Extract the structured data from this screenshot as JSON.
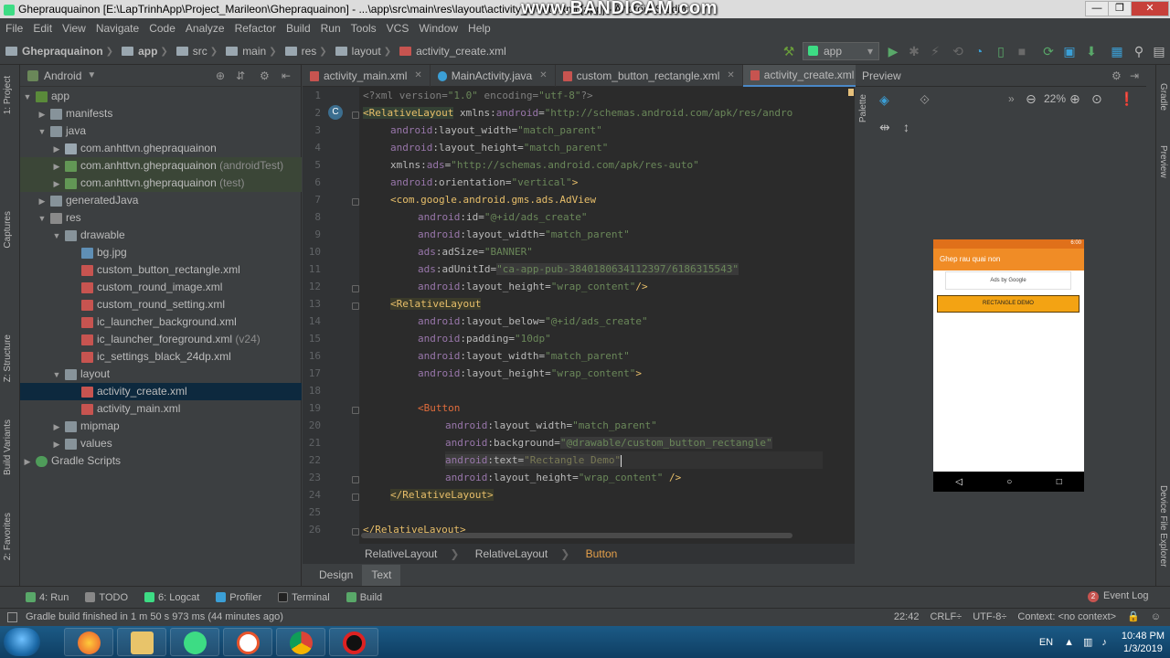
{
  "window": {
    "title": "Gheprauquainon [E:\\LapTrinhApp\\Project_Marileon\\Ghepraquainon] - ...\\app\\src\\main\\res\\layout\\activity_create.xml [app] - Android Studio",
    "watermark": "www.BANDICAM.com",
    "min": "—",
    "max": "❐",
    "close": "✕"
  },
  "menu": [
    "File",
    "Edit",
    "View",
    "Navigate",
    "Code",
    "Analyze",
    "Refactor",
    "Build",
    "Run",
    "Tools",
    "VCS",
    "Window",
    "Help"
  ],
  "breadcrumb": [
    "Ghepraquainon",
    "app",
    "src",
    "main",
    "res",
    "layout",
    "activity_create.xml"
  ],
  "run_config": "app",
  "left_strip": [
    "1: Project",
    "Captures",
    "Z: Structure",
    "Build Variants",
    "2: Favorites"
  ],
  "project": {
    "view": "Android",
    "tree": [
      {
        "label": "app",
        "suffix": ""
      },
      {
        "label": "manifests",
        "suffix": ""
      },
      {
        "label": "java",
        "suffix": ""
      },
      {
        "label": "com.anhttvn.ghepraquainon",
        "suffix": ""
      },
      {
        "label": "com.anhttvn.ghepraquainon",
        "suffix": " (androidTest)"
      },
      {
        "label": "com.anhttvn.ghepraquainon",
        "suffix": " (test)"
      },
      {
        "label": "generatedJava",
        "suffix": ""
      },
      {
        "label": "res",
        "suffix": ""
      },
      {
        "label": "drawable",
        "suffix": ""
      },
      {
        "label": "bg.jpg",
        "suffix": ""
      },
      {
        "label": "custom_button_rectangle.xml",
        "suffix": ""
      },
      {
        "label": "custom_round_image.xml",
        "suffix": ""
      },
      {
        "label": "custom_round_setting.xml",
        "suffix": ""
      },
      {
        "label": "ic_launcher_background.xml",
        "suffix": ""
      },
      {
        "label": "ic_launcher_foreground.xml",
        "suffix": " (v24)"
      },
      {
        "label": "ic_settings_black_24dp.xml",
        "suffix": ""
      },
      {
        "label": "layout",
        "suffix": ""
      },
      {
        "label": "activity_create.xml",
        "suffix": ""
      },
      {
        "label": "activity_main.xml",
        "suffix": ""
      },
      {
        "label": "mipmap",
        "suffix": ""
      },
      {
        "label": "values",
        "suffix": ""
      },
      {
        "label": "Gradle Scripts",
        "suffix": ""
      }
    ]
  },
  "editor_tabs": [
    "activity_main.xml",
    "MainActivity.java",
    "custom_button_rectangle.xml",
    "activity_create.xml"
  ],
  "code": {
    "line_numbers": [
      "1",
      "2",
      "3",
      "4",
      "5",
      "6",
      "7",
      "8",
      "9",
      "10",
      "11",
      "12",
      "13",
      "14",
      "15",
      "16",
      "17",
      "18",
      "19",
      "20",
      "21",
      "22",
      "23",
      "24",
      "25",
      "26"
    ],
    "l1a": "<?xml version=",
    "l1b": "\"1.0\"",
    "l1c": " encoding=",
    "l1d": "\"utf-8\"",
    "l1e": "?>",
    "l2a": "<RelativeLayout",
    "l2b": " xmlns:",
    "l2c": "android",
    "l2d": "=",
    "l2e": "\"http://schemas.android.com/apk/res/andro",
    "l3a": "android",
    "l3b": ":layout_width=",
    "l3c": "\"match_parent\"",
    "l4a": "android",
    "l4b": ":layout_height=",
    "l4c": "\"match_parent\"",
    "l5a": "xmlns:",
    "l5b": "ads",
    "l5c": "=",
    "l5d": "\"http://schemas.android.com/apk/res-auto\"",
    "l6a": "android",
    "l6b": ":orientation=",
    "l6c": "\"vertical\"",
    "l6d": ">",
    "l7a": "<com.google.android.gms.ads.AdView",
    "l8a": "android",
    "l8b": ":id=",
    "l8c": "\"@+id/ads_create\"",
    "l9a": "android",
    "l9b": ":layout_width=",
    "l9c": "\"match_parent\"",
    "l10a": "ads",
    "l10b": ":adSize=",
    "l10c": "\"BANNER\"",
    "l11a": "ads",
    "l11b": ":adUnitId=",
    "l11c": "\"ca-app-pub-3840180634112397/6186315543\"",
    "l12a": "android",
    "l12b": ":layout_height=",
    "l12c": "\"wrap_content\"",
    "l12d": "/>",
    "l13a": "<RelativeLayout",
    "l14a": "android",
    "l14b": ":layout_below=",
    "l14c": "\"@+id/ads_create\"",
    "l15a": "android",
    "l15b": ":padding=",
    "l15c": "\"10dp\"",
    "l16a": "android",
    "l16b": ":layout_width=",
    "l16c": "\"match_parent\"",
    "l17a": "android",
    "l17b": ":layout_height=",
    "l17c": "\"wrap_content\"",
    "l17d": ">",
    "l19a": "<Button",
    "l20a": "android",
    "l20b": ":layout_width=",
    "l20c": "\"match_parent\"",
    "l21a": "android",
    "l21b": ":background=",
    "l21c": "\"@drawable/custom_button_rectangle\"",
    "l22a": "android",
    "l22b": ":text=",
    "l22c": "\"Rectangle Demo\"",
    "l23a": "android",
    "l23b": ":layout_height=",
    "l23c": "\"wrap_content\"",
    "l23d": " />",
    "l24a": "</RelativeLayout>",
    "l26a": "</RelativeLayout>"
  },
  "editor_crumbs": [
    "RelativeLayout",
    "RelativeLayout",
    "Button"
  ],
  "design_tabs": [
    "Design",
    "Text"
  ],
  "preview": {
    "title": "Preview",
    "zoom": "22%",
    "palette_label": "Palette",
    "phone": {
      "time": "6:00",
      "app_title": "Ghep rau quai non",
      "ad_text": "Ads by Google",
      "button_text": "RECTANGLE DEMO"
    }
  },
  "right_strip": [
    "Gradle",
    "Preview",
    "Device File Explorer"
  ],
  "tool_windows": [
    "4: Run",
    "TODO",
    "6: Logcat",
    "Profiler",
    "Terminal",
    "Build"
  ],
  "event_log": {
    "label": "Event Log",
    "count": "2"
  },
  "status": {
    "message": "Gradle build finished in 1 m 50 s 973 ms (44 minutes ago)",
    "position": "22:42",
    "line_sep": "CRLF÷",
    "encoding": "UTF-8÷",
    "context": "Context: <no context>"
  },
  "taskbar": {
    "lang": "EN",
    "time": "10:48 PM",
    "date": "1/3/2019"
  }
}
